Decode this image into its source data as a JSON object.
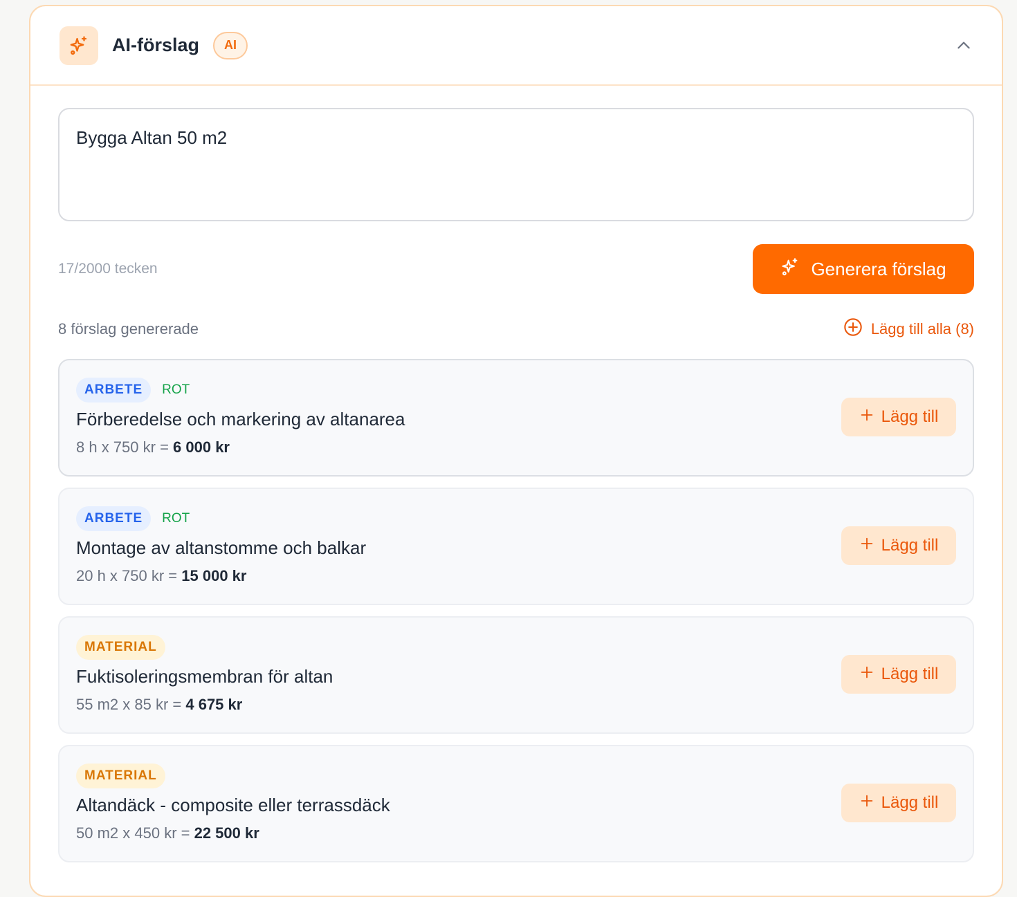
{
  "header": {
    "title": "AI-förslag",
    "badge": "AI",
    "icon": "sparkles-icon",
    "collapse_icon": "chevron-up-icon"
  },
  "prompt": {
    "value": "Bygga Altan 50 m2",
    "char_count": "17/2000 tecken"
  },
  "generate_button": {
    "label": "Generera förslag",
    "icon": "sparkles-icon"
  },
  "summary": {
    "count_text": "8 förslag genererade",
    "add_all_label": "Lägg till alla (8)"
  },
  "suggestions": [
    {
      "type_tag": "ARBETE",
      "rot_tag": "ROT",
      "title": "Förberedelse och markering av altanarea",
      "calc": "8 h x 750 kr = ",
      "total": "6 000 kr",
      "add_label": "Lägg till"
    },
    {
      "type_tag": "ARBETE",
      "rot_tag": "ROT",
      "title": "Montage av altanstomme och balkar",
      "calc": "20 h x 750 kr = ",
      "total": "15 000 kr",
      "add_label": "Lägg till"
    },
    {
      "type_tag": "MATERIAL",
      "title": "Fuktisoleringsmembran för altan",
      "calc": "55 m2 x 85 kr = ",
      "total": "4 675 kr",
      "add_label": "Lägg till"
    },
    {
      "type_tag": "MATERIAL",
      "title": "Altandäck - composite eller terrassdäck",
      "calc": "50 m2 x 450 kr = ",
      "total": "22 500 kr",
      "add_label": "Lägg till"
    }
  ],
  "colors": {
    "accent": "#ff6a00",
    "arbete": "#2563eb",
    "material": "#d97706",
    "rot": "#16a34a"
  }
}
